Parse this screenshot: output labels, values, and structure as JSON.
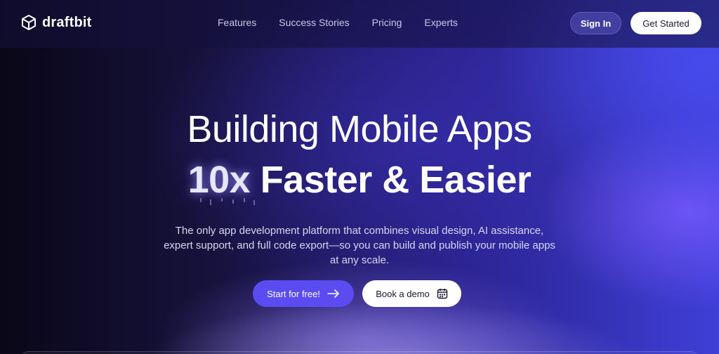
{
  "header": {
    "logo_text": "draftbit",
    "nav": [
      "Features",
      "Success Stories",
      "Pricing",
      "Experts"
    ],
    "sign_in": "Sign In",
    "get_started": "Get Started"
  },
  "hero": {
    "line1": "Building Mobile Apps",
    "highlight": "10x",
    "line2_rest": "Faster & Easier",
    "subtitle": "The only app development platform that combines visual design, AI assistance, expert support, and full code export—so you can build and publish your mobile apps at any scale.",
    "cta_primary": "Start for free!",
    "cta_secondary": "Book a demo"
  },
  "icons": {
    "logo": "box-icon",
    "primary_arrow": "arrow-right-icon",
    "demo_icon": "calendar-icon"
  },
  "colors": {
    "accent": "#5a4cf0",
    "background_dark": "#0b0820",
    "background_blue": "#3f3fd8"
  }
}
